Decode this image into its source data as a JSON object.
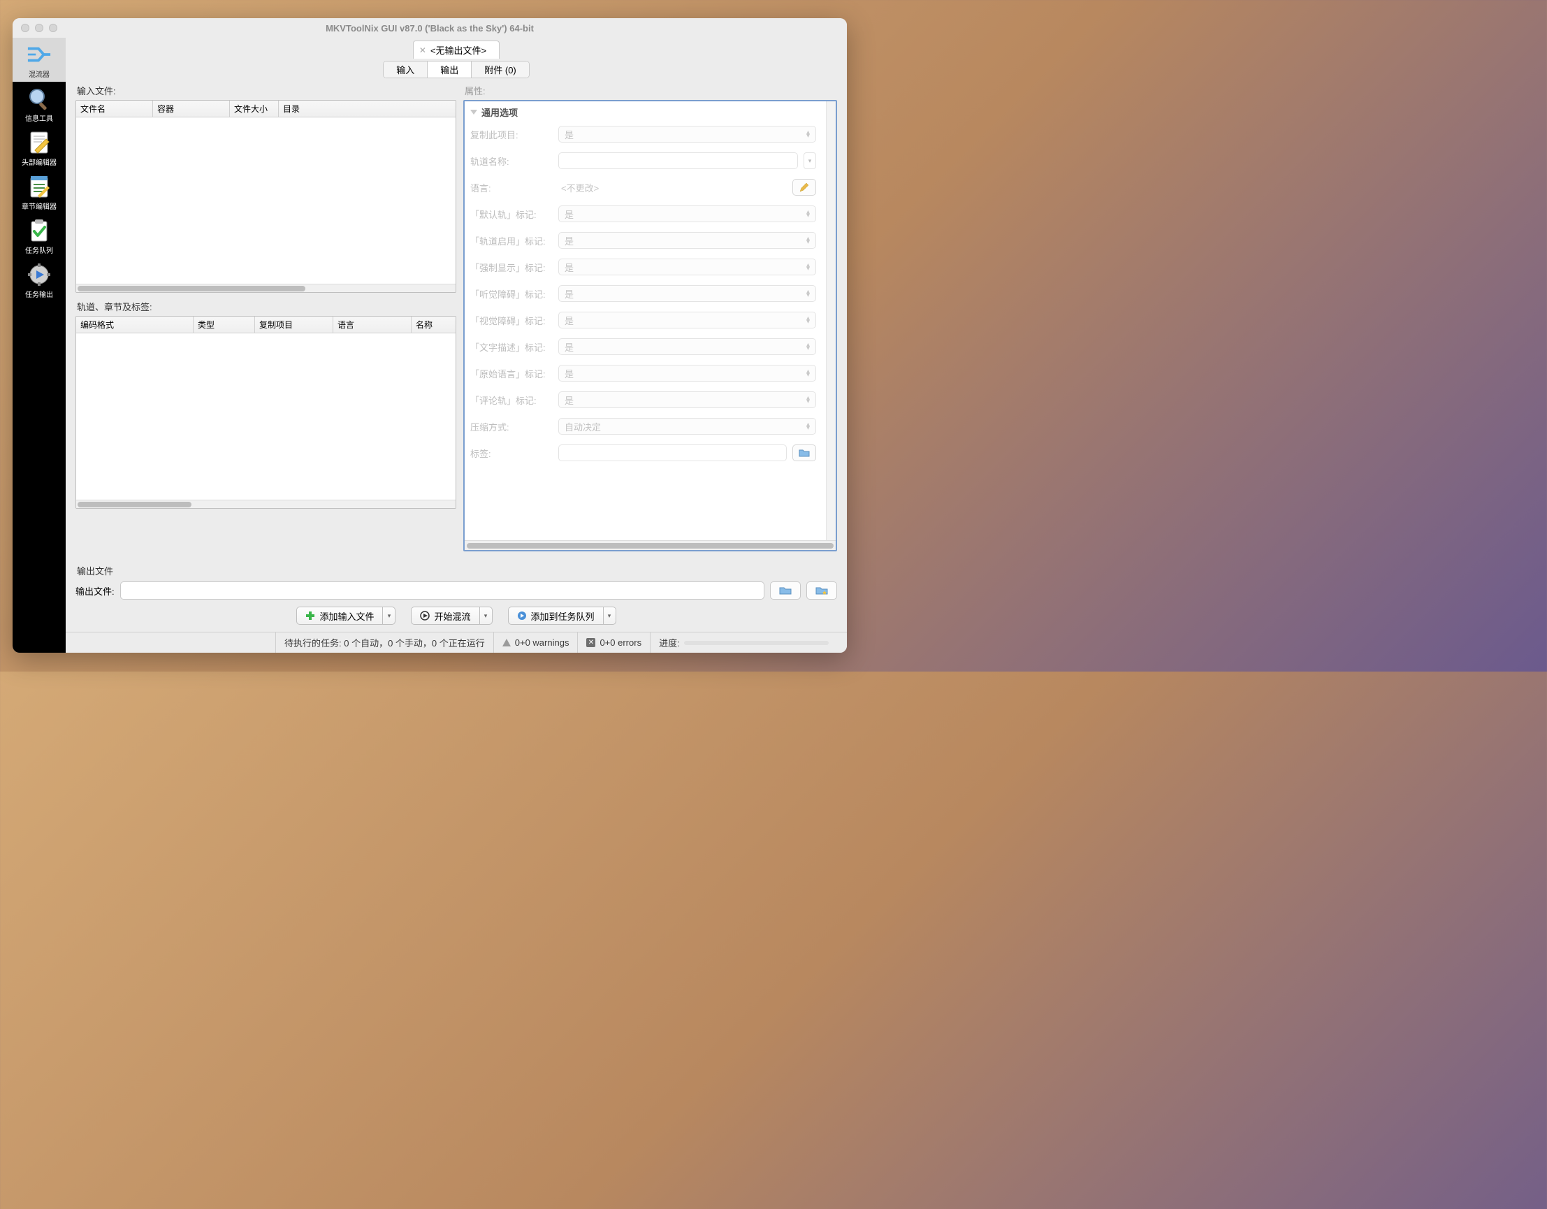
{
  "window": {
    "title": "MKVToolNix GUI v87.0 ('Black as the Sky') 64-bit"
  },
  "sidebar": {
    "items": [
      {
        "label": "混流器"
      },
      {
        "label": "信息工具"
      },
      {
        "label": "头部编辑器"
      },
      {
        "label": "章节编辑器"
      },
      {
        "label": "任务队列"
      },
      {
        "label": "任务输出"
      }
    ]
  },
  "doctab": {
    "label": "<无输出文件>"
  },
  "subtabs": {
    "input": "输入",
    "output": "输出",
    "attachments": "附件 (0)"
  },
  "input_section": {
    "label": "输入文件:",
    "columns": {
      "name": "文件名",
      "container": "容器",
      "size": "文件大小",
      "dir": "目录"
    }
  },
  "tracks_section": {
    "label": "轨道、章节及标签:",
    "columns": {
      "codec": "编码格式",
      "type": "类型",
      "copy": "复制项目",
      "lang": "语言",
      "name": "名称"
    }
  },
  "props": {
    "label": "属性:",
    "group": "通用选项",
    "rows": {
      "copy": {
        "label": "复制此项目:",
        "value": "是"
      },
      "trackname": {
        "label": "轨道名称:"
      },
      "lang": {
        "label": "语言:",
        "value": "<不更改>"
      },
      "default": {
        "label": "「默认轨」标记:",
        "value": "是"
      },
      "enabled": {
        "label": "「轨道启用」标记:",
        "value": "是"
      },
      "forced": {
        "label": "「强制显示」标记:",
        "value": "是"
      },
      "hearing": {
        "label": "「听觉障碍」标记:",
        "value": "是"
      },
      "visual": {
        "label": "「视觉障碍」标记:",
        "value": "是"
      },
      "textdesc": {
        "label": "「文字描述」标记:",
        "value": "是"
      },
      "origlang": {
        "label": "「原始语言」标记:",
        "value": "是"
      },
      "commentary": {
        "label": "「评论轨」标记:",
        "value": "是"
      },
      "compression": {
        "label": "压缩方式:",
        "value": "自动决定"
      },
      "tags": {
        "label": "标签:"
      }
    }
  },
  "output": {
    "section": "输出文件",
    "label": "输出文件:"
  },
  "actions": {
    "add": "添加输入文件",
    "start": "开始混流",
    "queue": "添加到任务队列"
  },
  "status": {
    "jobs": "待执行的任务: 0 个自动，0 个手动，0 个正在运行",
    "warnings": "0+0 warnings",
    "errors": "0+0 errors",
    "progress": "进度:"
  }
}
